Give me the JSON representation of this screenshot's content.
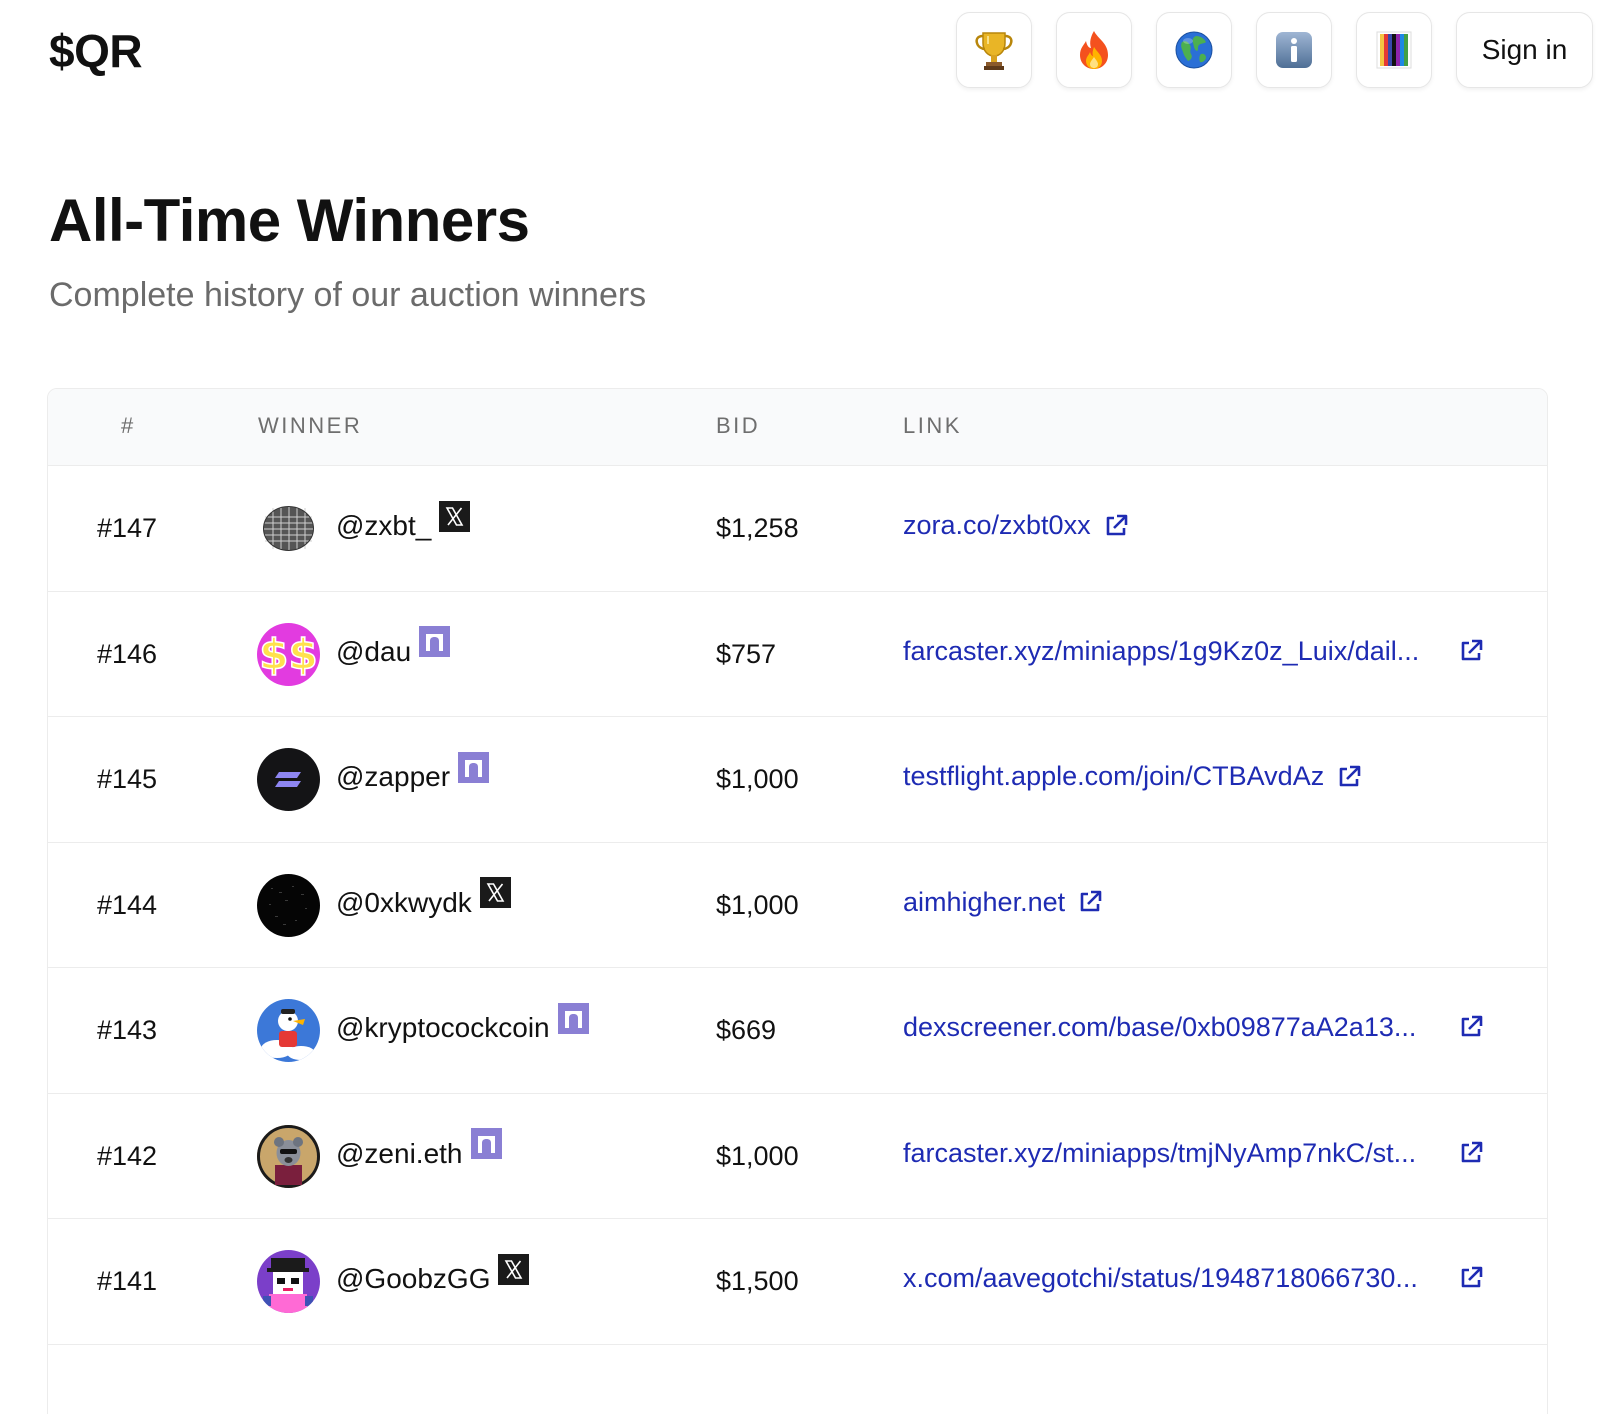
{
  "header": {
    "brand": "$QR",
    "nav": [
      {
        "icon": "trophy-icon"
      },
      {
        "icon": "fire-icon"
      },
      {
        "icon": "globe-icon"
      },
      {
        "icon": "info-icon"
      },
      {
        "icon": "color-bars-icon"
      }
    ],
    "signin_label": "Sign in"
  },
  "main": {
    "title": "All-Time Winners",
    "subtitle": "Complete history of our auction winners"
  },
  "table": {
    "columns": [
      "#",
      "WINNER",
      "BID",
      "LINK"
    ],
    "rows": [
      {
        "rank": "#147",
        "handle": "@zxbt_",
        "platform": "x-icon",
        "avatar": "disco-ball-avatar",
        "bid": "$1,258",
        "link": "zora.co/zxbt0xx"
      },
      {
        "rank": "#146",
        "handle": "@dau",
        "platform": "farcaster-icon",
        "avatar": "dollar-avatar",
        "bid": "$757",
        "link": "farcaster.xyz/miniapps/1g9Kz0z_Luix/dail..."
      },
      {
        "rank": "#145",
        "handle": "@zapper",
        "platform": "farcaster-icon",
        "avatar": "zapper-logo-avatar",
        "bid": "$1,000",
        "link": "testflight.apple.com/join/CTBAvdAz"
      },
      {
        "rank": "#144",
        "handle": "@0xkwydk",
        "platform": "x-icon",
        "avatar": "dark-avatar",
        "bid": "$1,000",
        "link": "aimhigher.net"
      },
      {
        "rank": "#143",
        "handle": "@kryptocockcoin",
        "platform": "farcaster-icon",
        "avatar": "cartoon-avatar",
        "bid": "$669",
        "link": "dexscreener.com/base/0xb09877aA2a13..."
      },
      {
        "rank": "#142",
        "handle": "@zeni.eth",
        "platform": "farcaster-icon",
        "avatar": "character-avatar",
        "bid": "$1,000",
        "link": "farcaster.xyz/miniapps/tmjNyAmp7nkC/st..."
      },
      {
        "rank": "#141",
        "handle": "@GoobzGG",
        "platform": "x-icon",
        "avatar": "pixel-character-avatar",
        "bid": "$1,500",
        "link": "x.com/aavegotchi/status/1948718066730..."
      }
    ]
  },
  "colors": {
    "link": "#1e2bb3",
    "farcaster": "#8a7fd4",
    "header_bg": "#f9fafb",
    "border": "#ececec"
  }
}
